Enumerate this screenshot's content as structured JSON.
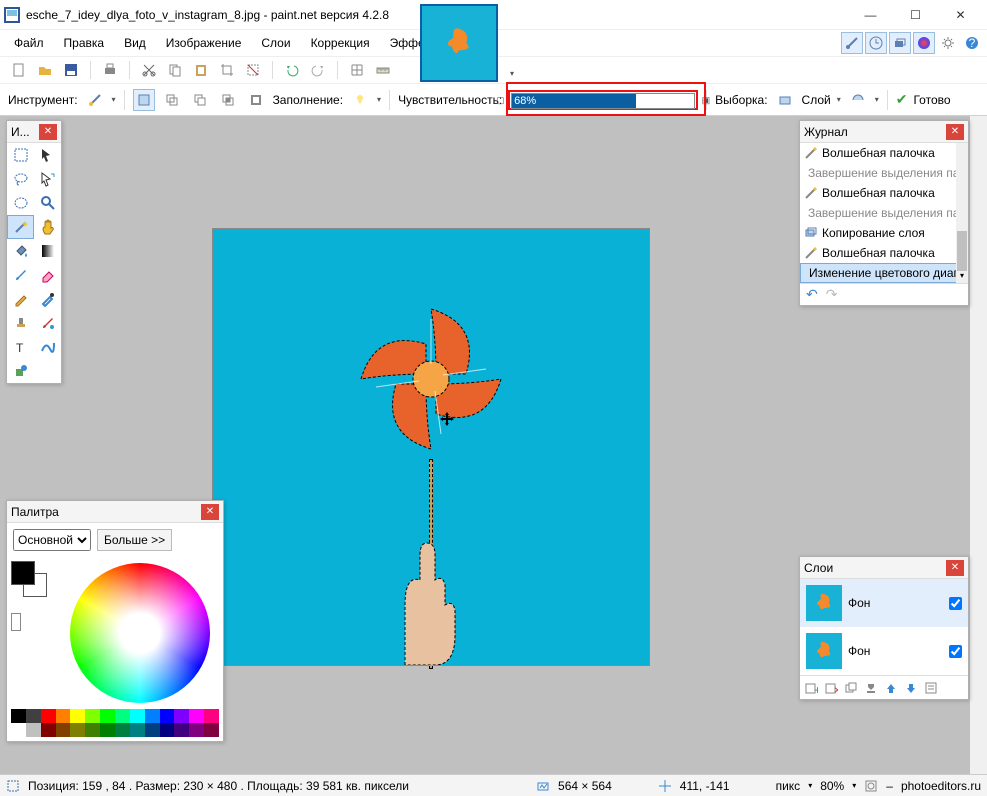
{
  "window": {
    "title": "esche_7_idey_dlya_foto_v_instagram_8.jpg - paint.net версия 4.2.8",
    "min": "—",
    "max": "☐",
    "close": "✕"
  },
  "menu": {
    "file": "Файл",
    "edit": "Правка",
    "view": "Вид",
    "image": "Изображение",
    "layers": "Слои",
    "adjust": "Коррекция",
    "effects": "Эффекты"
  },
  "tooloptions": {
    "tool_label": "Инструмент:",
    "fill_label": "Заполнение:",
    "tolerance_label": "Чувствительность:",
    "tolerance_value": "68%",
    "tolerance_fill_pct": 68,
    "selection_label": "Выборка:",
    "selection_value": "Слой",
    "commit_label": "Готово"
  },
  "tools_panel": {
    "title": "И..."
  },
  "palette_panel": {
    "title": "Палитра",
    "mode": "Основной",
    "more": "Больше >>"
  },
  "history_panel": {
    "title": "Журнал",
    "items": [
      {
        "label": "Волшебная палочка",
        "dim": false
      },
      {
        "label": "Завершение выделения палочкой",
        "dim": true
      },
      {
        "label": "Волшебная палочка",
        "dim": false
      },
      {
        "label": "Завершение выделения палочкой",
        "dim": true
      },
      {
        "label": "Копирование слоя",
        "dim": false
      },
      {
        "label": "Волшебная палочка",
        "dim": false
      },
      {
        "label": "Изменение цветового диапазона",
        "dim": false,
        "selected": true
      }
    ]
  },
  "layers_panel": {
    "title": "Слои",
    "items": [
      {
        "name": "Фон",
        "checked": true,
        "selected": true
      },
      {
        "name": "Фон",
        "checked": true,
        "selected": false
      }
    ]
  },
  "status": {
    "pos_label": "Позиция: 159 , 84 . Размер: 230   × 480 . Площадь: 39 581 кв. пиксели",
    "image_size": "564 × 564",
    "cursor_pos": "411, -141",
    "units": "пикс",
    "zoom": "80%",
    "site": "photoeditors.ru"
  }
}
